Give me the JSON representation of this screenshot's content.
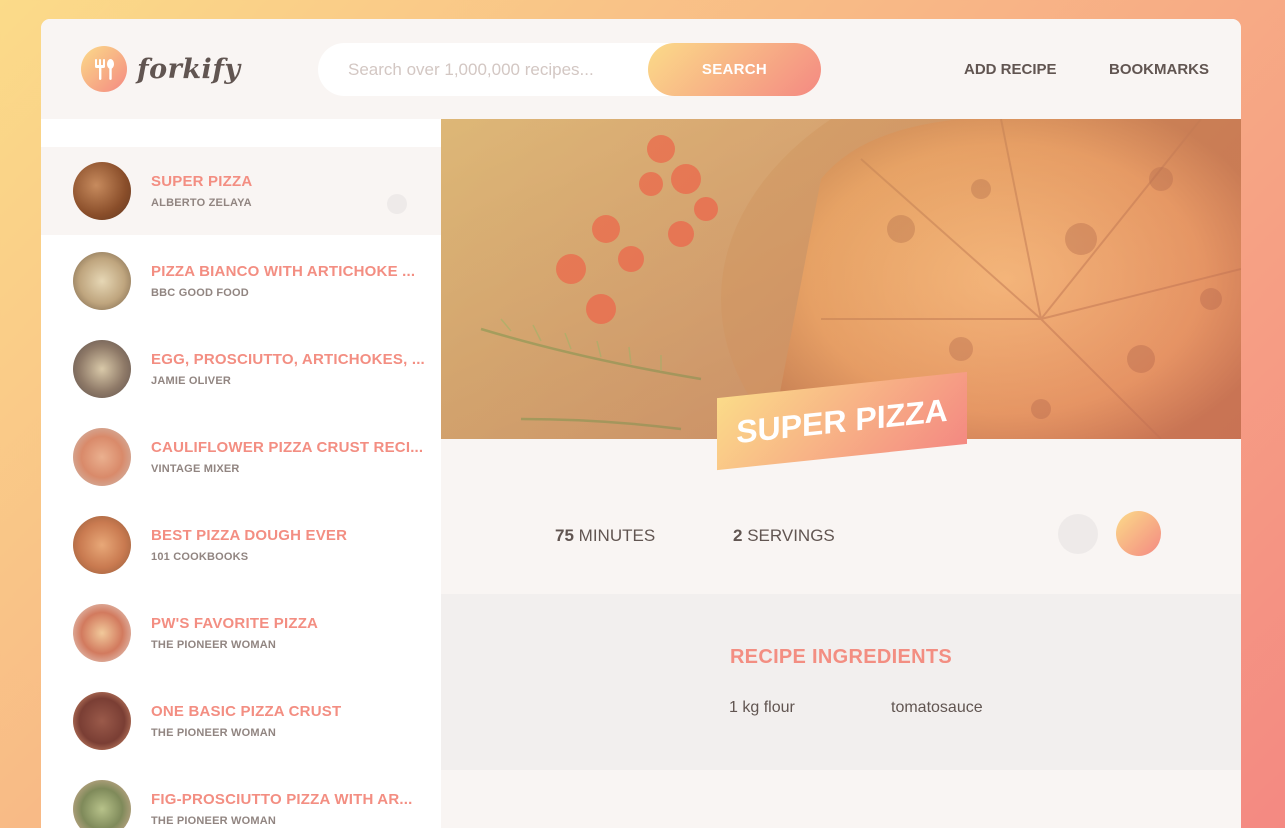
{
  "app": {
    "name": "forkify"
  },
  "search": {
    "placeholder": "Search over 1,000,000 recipes...",
    "button_label": "SEARCH"
  },
  "nav": {
    "add_recipe": "ADD RECIPE",
    "bookmarks": "BOOKMARKS"
  },
  "results": [
    {
      "title": "SUPER PIZZA",
      "publisher": "ALBERTO ZELAYA",
      "active": true
    },
    {
      "title": "PIZZA BIANCO WITH ARTICHOKE ...",
      "publisher": "BBC GOOD FOOD"
    },
    {
      "title": "EGG, PROSCIUTTO, ARTICHOKES, ...",
      "publisher": "JAMIE OLIVER"
    },
    {
      "title": "CAULIFLOWER PIZZA CRUST RECI...",
      "publisher": "VINTAGE MIXER"
    },
    {
      "title": "BEST PIZZA DOUGH EVER",
      "publisher": "101 COOKBOOKS"
    },
    {
      "title": "PW'S FAVORITE PIZZA",
      "publisher": "THE PIONEER WOMAN"
    },
    {
      "title": "ONE BASIC PIZZA CRUST",
      "publisher": "THE PIONEER WOMAN"
    },
    {
      "title": "FIG-PROSCIUTTO PIZZA WITH AR...",
      "publisher": "THE PIONEER WOMAN"
    }
  ],
  "recipe": {
    "title": "SUPER PIZZA",
    "minutes": "75",
    "minutes_label": "MINUTES",
    "servings": "2",
    "servings_label": "SERVINGS",
    "ingredients_heading": "RECIPE INGREDIENTS",
    "ingredients": [
      "1 kg flour",
      "tomatosauce"
    ]
  },
  "colors": {
    "accent": "#f38e82",
    "gradient_start": "#fbdb89",
    "gradient_end": "#f48982",
    "text": "#615551"
  }
}
